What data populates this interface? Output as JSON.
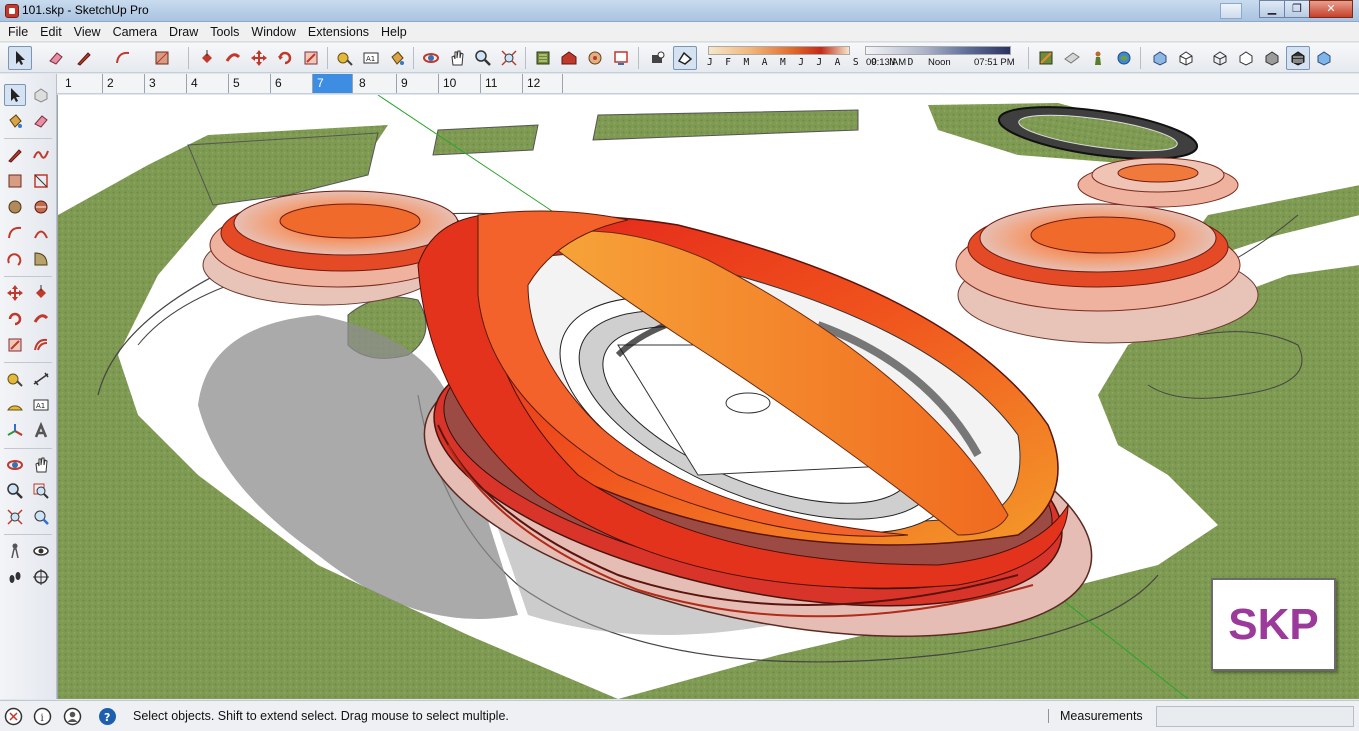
{
  "window": {
    "title": "101.skp - SketchUp Pro",
    "controls": {
      "minimize": "▁",
      "maximize": "❐",
      "close": "✕"
    }
  },
  "menu": {
    "items": [
      "File",
      "Edit",
      "View",
      "Camera",
      "Draw",
      "Tools",
      "Window",
      "Extensions",
      "Help"
    ]
  },
  "toolbar": {
    "shadow_months": "J F M A M J J A S O N D",
    "time_start": "09:13 AM",
    "time_mid": "Noon",
    "time_end": "07:51 PM",
    "icons": [
      "select-icon",
      "eraser-icon",
      "pencil-icon",
      "arc-icon",
      "shape-icon",
      "push-pull-icon",
      "follow-me-icon",
      "move-icon",
      "rotate-icon",
      "scale-icon",
      "tape-measure-icon",
      "text-icon",
      "paint-bucket-icon",
      "orbit-icon",
      "pan-icon",
      "zoom-icon",
      "zoom-extents-icon",
      "warehouse-icon",
      "extension-warehouse-icon",
      "components-icon",
      "send-to-layout-icon",
      "shadows-icon",
      "fog-icon",
      "section-plane-icon",
      "section-display-icon",
      "position-camera-icon",
      "geo-location-icon",
      "xray-icon",
      "wireframe-icon",
      "hidden-line-icon",
      "shaded-icon",
      "shaded-texture-icon",
      "monochrome-icon"
    ]
  },
  "scenes": {
    "tabs": [
      "1",
      "2",
      "3",
      "4",
      "5",
      "6",
      "7",
      "8",
      "9",
      "10",
      "11",
      "12"
    ],
    "active_index": 6
  },
  "viewport": {
    "badge_text": "SKP",
    "colors": {
      "ground": "#7f9a52",
      "road": "#ffffff",
      "ribbon_red": "#d8261b",
      "ribbon_orange": "#f08a1f",
      "shadow": "#9e9e9e"
    }
  },
  "status": {
    "message": "Select objects. Shift to extend select. Drag mouse to select multiple.",
    "measurements_label": "Measurements",
    "measurements_value": ""
  }
}
